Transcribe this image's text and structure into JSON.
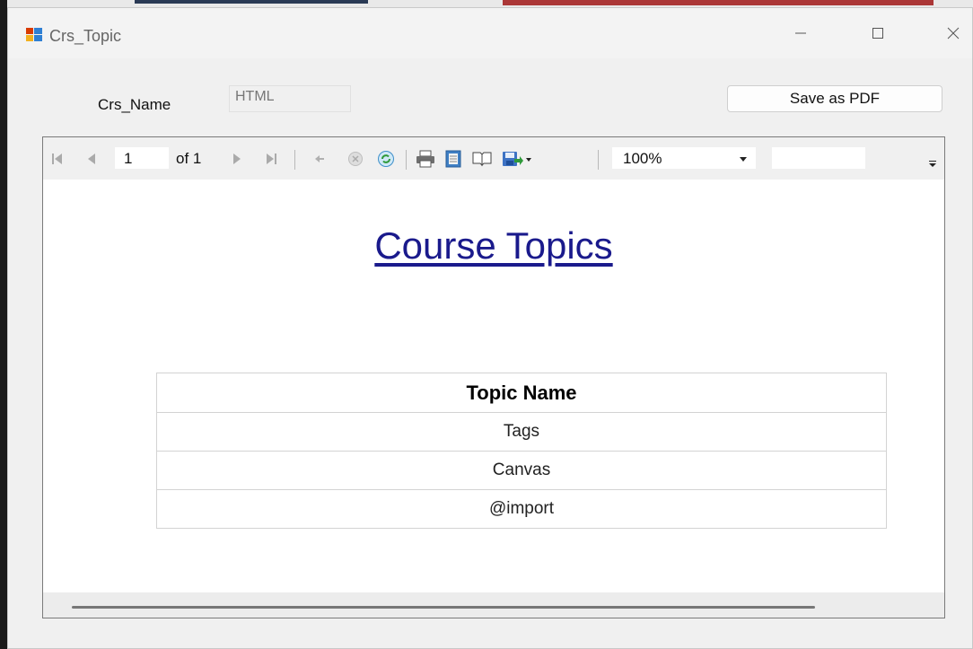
{
  "window": {
    "title": "Crs_Topic"
  },
  "form": {
    "crs_name_label": "Crs_Name",
    "crs_name_value": "HTML",
    "save_button_label": "Save as PDF"
  },
  "toolbar": {
    "current_page": "1",
    "of_pages": "of 1",
    "zoom": "100%",
    "icons": [
      "first-page-icon",
      "previous-page-icon",
      "next-page-icon",
      "last-page-icon",
      "back-icon",
      "stop-icon",
      "refresh-icon",
      "print-icon",
      "print-layout-icon",
      "page-setup-icon",
      "export-icon"
    ]
  },
  "report": {
    "title": "Course Topics",
    "table": {
      "header": "Topic Name",
      "rows": [
        "Tags",
        "Canvas",
        "@import"
      ]
    }
  },
  "colors": {
    "title_link": "#1a1a8c",
    "window_bg": "#f0f0f0"
  }
}
